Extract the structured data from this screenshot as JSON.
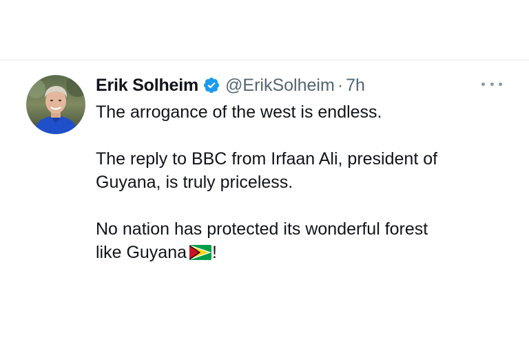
{
  "tweet": {
    "display_name": "Erik Solheim",
    "handle": "@ErikSolheim",
    "separator": "·",
    "time": "7h",
    "verified": true,
    "avatar_icon": "profile-photo",
    "more_icon": "more-horizontal-icon",
    "paragraphs": {
      "p1": "The arrogance of the west is endless.",
      "p2_l1": "The reply to BBC from Irfaan Ali, president of",
      "p2_l2": "Guyana, is truly priceless.",
      "p3_l1": "No nation has protected its wonderful forest",
      "p3_l2_before": "like Guyana",
      "p3_l2_after": "!"
    },
    "emoji": "guyana-flag",
    "colors": {
      "verified_blue": "#1d9bf0",
      "secondary_text": "#536471",
      "primary_text": "#0f1419"
    }
  }
}
